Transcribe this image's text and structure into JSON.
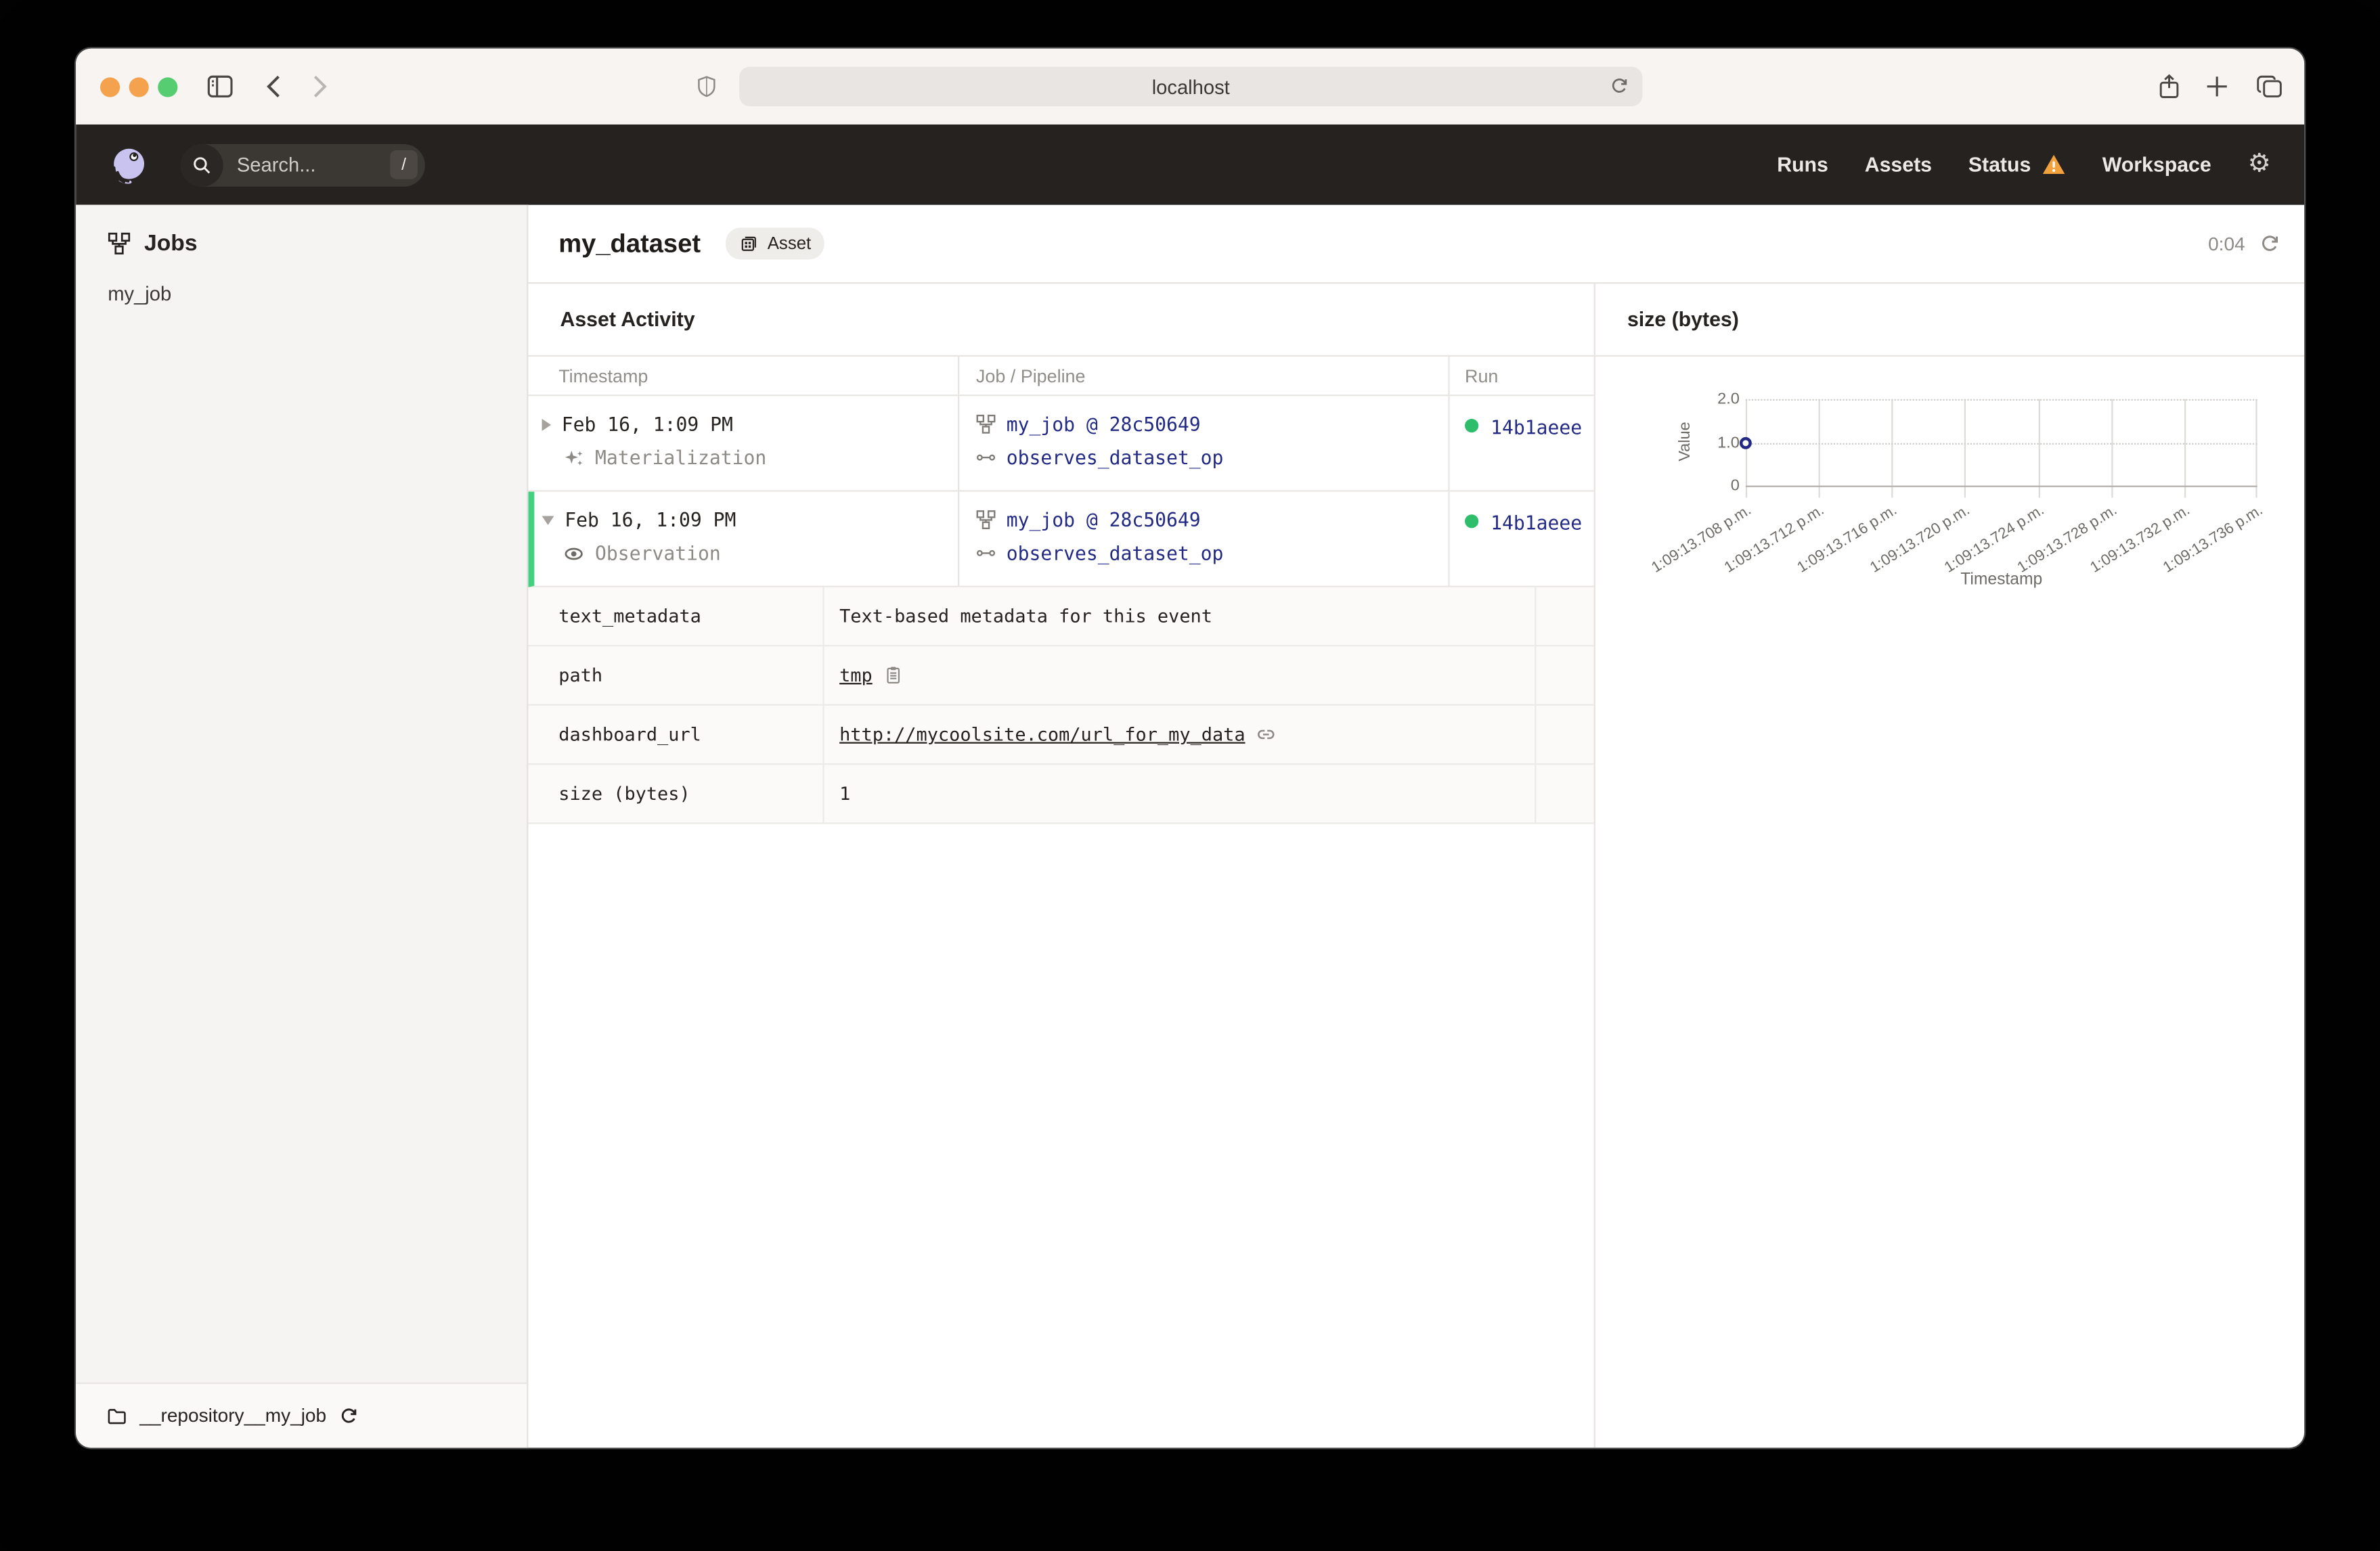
{
  "browser": {
    "url": "localhost",
    "traffic_lights": [
      "#F4A24E",
      "#F4A24E",
      "#57CD72"
    ]
  },
  "icons": {
    "gear": "⚙"
  },
  "app_header": {
    "search_placeholder": "Search...",
    "search_shortcut": "/",
    "nav": [
      "Runs",
      "Assets",
      "Status",
      "Workspace"
    ]
  },
  "sidebar": {
    "title": "Jobs",
    "items": [
      {
        "label": "my_job"
      }
    ],
    "footer_repo": "__repository__my_job"
  },
  "main": {
    "title": "my_dataset",
    "asset_tag": "Asset",
    "refresh_timer": "0:04",
    "activity": {
      "heading": "Asset Activity",
      "columns": [
        "Timestamp",
        "Job / Pipeline",
        "Run"
      ],
      "rows": [
        {
          "timestamp": "Feb 16, 1:09 PM",
          "event_type": "Materialization",
          "job": "my_job @ 28c50649",
          "op": "observes_dataset_op",
          "run_id": "14b1aeee",
          "expanded": false
        },
        {
          "timestamp": "Feb 16, 1:09 PM",
          "event_type": "Observation",
          "job": "my_job @ 28c50649",
          "op": "observes_dataset_op",
          "run_id": "14b1aeee",
          "expanded": true
        }
      ],
      "metadata": [
        {
          "key": "text_metadata",
          "value": "Text-based metadata for this event"
        },
        {
          "key": "path",
          "value": "tmp"
        },
        {
          "key": "dashboard_url",
          "value": "http://mycoolsite.com/url_for_my_data"
        },
        {
          "key": "size (bytes)",
          "value": "1"
        }
      ]
    }
  },
  "chart_data": {
    "type": "scatter",
    "title": "size (bytes)",
    "xlabel": "Timestamp",
    "ylabel": "Value",
    "ylim": [
      0,
      2
    ],
    "y_ticks": [
      "2.0",
      "1.0",
      "0"
    ],
    "x_ticks": [
      "1:09:13.708 p.m.",
      "1:09:13.712 p.m.",
      "1:09:13.716 p.m.",
      "1:09:13.720 p.m.",
      "1:09:13.724 p.m.",
      "1:09:13.728 p.m.",
      "1:09:13.732 p.m.",
      "1:09:13.736 p.m."
    ],
    "grid": true,
    "legend": false,
    "series": [
      {
        "name": "size (bytes)",
        "points": [
          {
            "x": "1:09:13.708 p.m.",
            "y": 1
          }
        ]
      }
    ]
  },
  "colors": {
    "header_bg": "#262220",
    "link_navy": "#232A85",
    "success_green": "#2EBE6B",
    "row_highlight_green": "#41D17F",
    "warning_orange": "#F2A13C",
    "logo_lavender": "#C9C3F0"
  }
}
